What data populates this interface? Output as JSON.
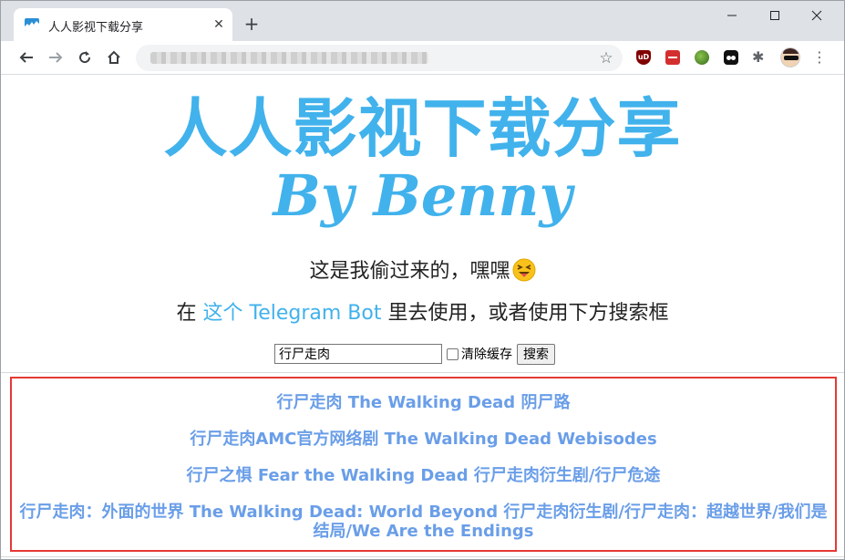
{
  "browser": {
    "tab": {
      "title": "人人影视下载分享",
      "close_glyph": "✕"
    },
    "new_tab_glyph": "+",
    "omnibox": {
      "url": "",
      "star_glyph": "☆"
    },
    "extensions": [
      {
        "name": "ublock-origin",
        "label": "uD"
      },
      {
        "name": "red-extension"
      },
      {
        "name": "globe-extension"
      },
      {
        "name": "tampermonkey"
      },
      {
        "name": "extensions-puzzle",
        "glyph": "✱"
      }
    ],
    "menu_glyph": "⋮",
    "icons": [
      "back-icon",
      "forward-icon",
      "reload-icon",
      "home-icon",
      "star-icon",
      "minimize-icon",
      "maximize-icon",
      "close-icon"
    ]
  },
  "page": {
    "hero_title": "人人影视下载分享",
    "hero_subtitle": "By Benny",
    "tagline": "这是我偷过来的，嘿嘿",
    "instruction": {
      "prefix": "在 ",
      "link": "这个 Telegram Bot",
      "suffix": " 里去使用，或者使用下方搜索框"
    },
    "search": {
      "value": "行尸走肉",
      "checkbox_label": "清除缓存",
      "button_label": "搜索"
    },
    "results": [
      "行尸走肉 The Walking Dead 阴尸路",
      "行尸走肉AMC官方网络剧 The Walking Dead Webisodes",
      "行尸之惧 Fear the Walking Dead 行尸走肉衍生剧/行尸危途",
      "行尸走肉：外面的世界 The Walking Dead: World Beyond 行尸走肉衍生剧/行尸走肉：超越世界/我们是结局/We Are the Endings"
    ]
  },
  "colors": {
    "brand_blue": "#41b2ec",
    "result_blue": "#6a9ee8",
    "highlight_red": "#e53935"
  }
}
